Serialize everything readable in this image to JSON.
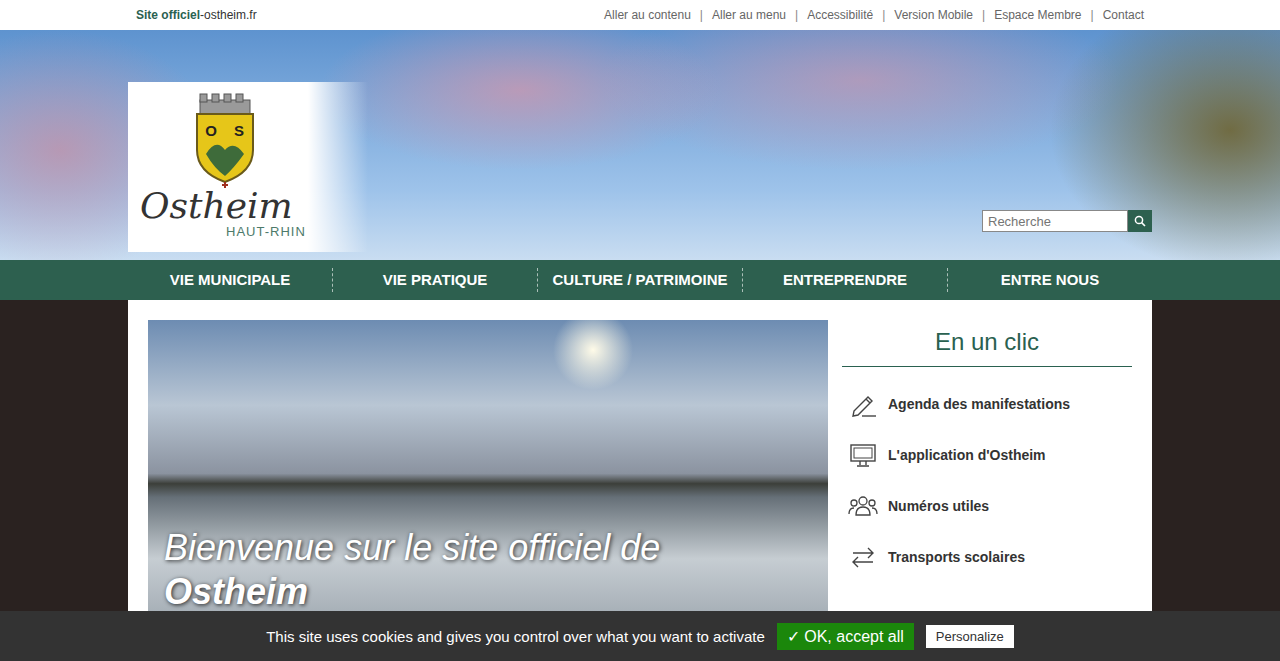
{
  "topbar": {
    "site_label": "Site officiel",
    "site_sep": "-",
    "site_domain": "ostheim.fr",
    "links": [
      "Aller au contenu",
      "Aller au menu",
      "Accessibilité",
      "Version Mobile",
      "Espace Membre",
      "Contact"
    ],
    "separator": "|"
  },
  "logo": {
    "name": "Ostheim",
    "region": "HAUT-RHIN",
    "shield_letters": [
      "O",
      "S"
    ]
  },
  "search": {
    "placeholder": "Recherche"
  },
  "nav": [
    "VIE MUNICIPALE",
    "VIE PRATIQUE",
    "CULTURE / PATRIMOINE",
    "ENTREPRENDRE",
    "ENTRE NOUS"
  ],
  "slider": {
    "caption_line1": "Bienvenue sur le site officiel de",
    "caption_line2": "Ostheim"
  },
  "quick_links": {
    "title": "En un clic",
    "items": [
      {
        "label": "Agenda des manifestations",
        "kind": "agenda"
      },
      {
        "label": "L'application d'Ostheim",
        "kind": "app"
      },
      {
        "label": "Numéros utiles",
        "kind": "contacts"
      },
      {
        "label": "Transports scolaires",
        "kind": "transport"
      }
    ]
  },
  "cookie": {
    "message": "This site uses cookies and gives you control over what you want to activate",
    "accept": "✓ OK, accept all",
    "personalize": "Personalize"
  }
}
